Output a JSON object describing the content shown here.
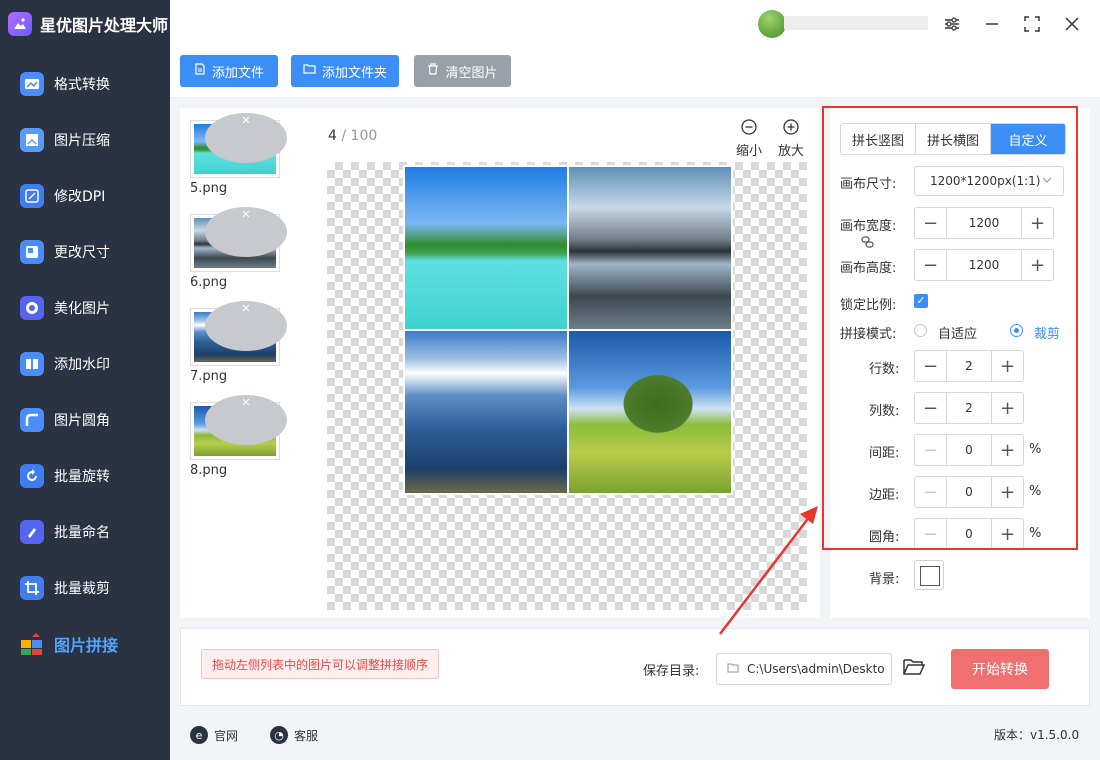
{
  "app": {
    "title": "星优图片处理大师"
  },
  "sidebar": {
    "items": [
      {
        "label": "格式转换",
        "icon": "format-convert-icon"
      },
      {
        "label": "图片压缩",
        "icon": "compress-icon"
      },
      {
        "label": "修改DPI",
        "icon": "dpi-icon"
      },
      {
        "label": "更改尺寸",
        "icon": "resize-icon"
      },
      {
        "label": "美化图片",
        "icon": "beautify-icon"
      },
      {
        "label": "添加水印",
        "icon": "watermark-icon"
      },
      {
        "label": "图片圆角",
        "icon": "round-corner-icon"
      },
      {
        "label": "批量旋转",
        "icon": "rotate-icon"
      },
      {
        "label": "批量命名",
        "icon": "rename-icon"
      },
      {
        "label": "批量裁剪",
        "icon": "crop-icon"
      },
      {
        "label": "图片拼接",
        "icon": "puzzle-icon",
        "active": true
      }
    ]
  },
  "toolbar": {
    "add_file": "添加文件",
    "add_folder": "添加文件夹",
    "clear": "清空图片"
  },
  "files": [
    {
      "name": "5.png"
    },
    {
      "name": "6.png"
    },
    {
      "name": "7.png"
    },
    {
      "name": "8.png"
    }
  ],
  "preview": {
    "current": "4",
    "separator": " / ",
    "total": "100",
    "zoom_out": "缩小",
    "zoom_in": "放大"
  },
  "settings": {
    "modes": [
      "拼长竖图",
      "拼长横图",
      "自定义"
    ],
    "canvas_size_label": "画布尺寸:",
    "canvas_size_value": "1200*1200px(1:1)",
    "width_label": "画布宽度:",
    "width_value": "1200",
    "height_label": "画布高度:",
    "height_value": "1200",
    "lock_label": "锁定比例:",
    "mode_label": "拼接模式:",
    "mode_auto": "自适应",
    "mode_crop": "裁剪",
    "rows_label": "行数:",
    "rows_value": "2",
    "cols_label": "列数:",
    "cols_value": "2",
    "spacing_label": "间距:",
    "spacing_value": "0",
    "margin_label": "边距:",
    "margin_value": "0",
    "radius_label": "圆角:",
    "radius_value": "0",
    "percent": "%",
    "bg_label": "背景:"
  },
  "bottom": {
    "hint": "拖动左侧列表中的图片可以调整拼接顺序",
    "save_label": "保存目录:",
    "save_path": "C:\\Users\\admin\\Deskto",
    "start": "开始转换"
  },
  "footer": {
    "website": "官网",
    "support": "客服",
    "version": "版本：v1.5.0.0"
  },
  "colors": {
    "primary": "#3a8ef6",
    "sidebar": "#2b3343",
    "highlight": "#e8362f",
    "start": "#f07070"
  }
}
